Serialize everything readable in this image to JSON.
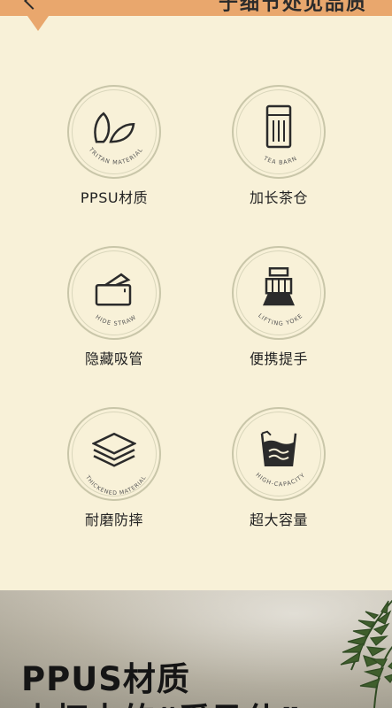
{
  "header": {
    "title": "于细节处见品质",
    "accent_color": "#e9a76d"
  },
  "features": [
    {
      "arc_label": "TRITAN MATERIAL",
      "title": "PPSU材质",
      "icon": "leaves-icon"
    },
    {
      "arc_label": "TEA BARN",
      "title": "加长茶仓",
      "icon": "tea-cup-icon"
    },
    {
      "arc_label": "HIDE STRAW",
      "title": "隐藏吸管",
      "icon": "hidden-straw-icon"
    },
    {
      "arc_label": "LIFTING YOKE",
      "title": "便携提手",
      "icon": "hand-grip-icon"
    },
    {
      "arc_label": "THICKENED MATERIAL",
      "title": "耐磨防摔",
      "icon": "layers-icon"
    },
    {
      "arc_label": "HIGH-CAPACITY",
      "title": "超大容量",
      "icon": "water-cup-icon"
    }
  ],
  "hero": {
    "title": "PPUS材质",
    "subtitle": "水杯中的“爱马仕”"
  }
}
